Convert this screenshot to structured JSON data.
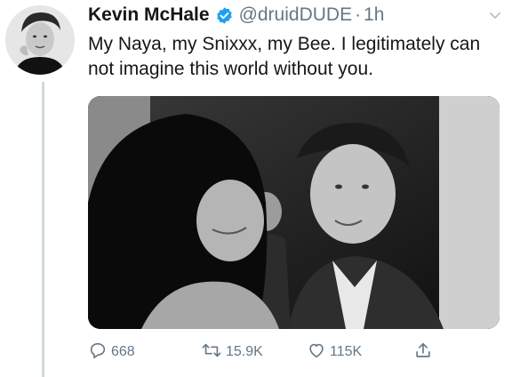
{
  "tweet": {
    "author": {
      "name": "Kevin McHale",
      "handle": "@druidDUDE",
      "verified": true,
      "avatar_icon": "profile-photo"
    },
    "separator": "·",
    "time": "1h",
    "text": "My Naya, my Snixxx, my Bee. I legitimately can not imagine this world without you.",
    "media": {
      "type": "photo",
      "style": "black-and-white"
    },
    "actions": {
      "replies": "668",
      "retweets": "15.9K",
      "likes": "115K"
    }
  },
  "icons": {
    "verified": "verified-badge-icon",
    "menu": "chevron-down-icon",
    "reply": "reply-icon",
    "retweet": "retweet-icon",
    "like": "heart-icon",
    "share": "share-icon"
  },
  "colors": {
    "text": "#14171a",
    "secondary": "#657786",
    "verified": "#1da1f2",
    "thread_line": "#cfd9de"
  }
}
